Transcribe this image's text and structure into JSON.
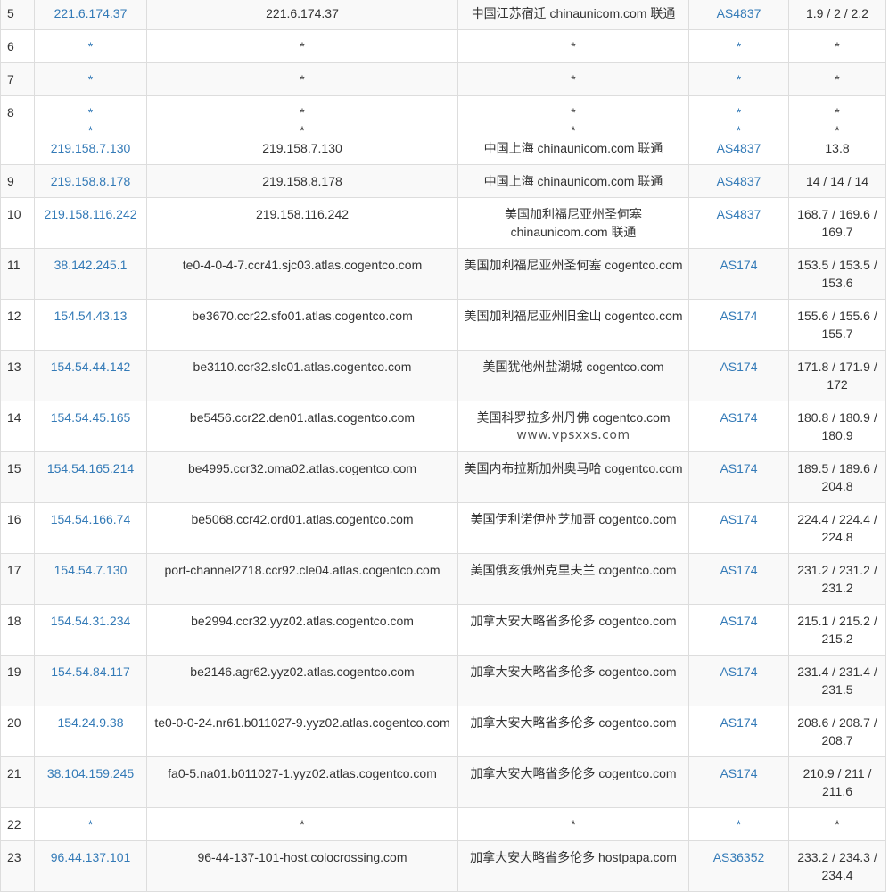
{
  "colors": {
    "link": "#337ab7",
    "text": "#333333",
    "stripe": "#f9f9f9",
    "border": "#dddddd"
  },
  "watermark": "www.vpsxxs.com",
  "rows": [
    {
      "hop": "5",
      "ip": "221.6.174.37",
      "host": "221.6.174.37",
      "loc": "中国江苏宿迁 chinaunicom.com 联通",
      "as": "AS4837",
      "time": "1.9 / 2 / 2.2"
    },
    {
      "hop": "6",
      "ip": "*",
      "host": "*",
      "loc": "*",
      "as": "*",
      "time": "*"
    },
    {
      "hop": "7",
      "ip": "*",
      "host": "*",
      "loc": "*",
      "as": "*",
      "time": "*"
    },
    {
      "hop": "8",
      "lines": [
        {
          "ip": "*",
          "host": "*",
          "loc": "*",
          "as": "*",
          "time": "*"
        },
        {
          "ip": "*",
          "host": "*",
          "loc": "*",
          "as": "*",
          "time": "*"
        },
        {
          "ip": "219.158.7.130",
          "host": "219.158.7.130",
          "loc": "中国上海 chinaunicom.com 联通",
          "as": "AS4837",
          "time": "13.8"
        }
      ]
    },
    {
      "hop": "9",
      "ip": "219.158.8.178",
      "host": "219.158.8.178",
      "loc": "中国上海 chinaunicom.com 联通",
      "as": "AS4837",
      "time": "14 / 14 / 14"
    },
    {
      "hop": "10",
      "ip": "219.158.116.242",
      "host": "219.158.116.242",
      "loc": "美国加利福尼亚州圣何塞 chinaunicom.com 联通",
      "as": "AS4837",
      "time": "168.7 / 169.6 / 169.7"
    },
    {
      "hop": "11",
      "ip": "38.142.245.1",
      "host": "te0-4-0-4-7.ccr41.sjc03.atlas.cogentco.com",
      "loc": "美国加利福尼亚州圣何塞 cogentco.com",
      "as": "AS174",
      "time": "153.5 / 153.5 / 153.6"
    },
    {
      "hop": "12",
      "ip": "154.54.43.13",
      "host": "be3670.ccr22.sfo01.atlas.cogentco.com",
      "loc": "美国加利福尼亚州旧金山 cogentco.com",
      "as": "AS174",
      "time": "155.6 / 155.6 / 155.7"
    },
    {
      "hop": "13",
      "ip": "154.54.44.142",
      "host": "be3110.ccr32.slc01.atlas.cogentco.com",
      "loc": "美国犹他州盐湖城 cogentco.com",
      "as": "AS174",
      "time": "171.8 / 171.9 / 172"
    },
    {
      "hop": "14",
      "ip": "154.54.45.165",
      "host": "be5456.ccr22.den01.atlas.cogentco.com",
      "loc": "美国科罗拉多州丹佛 cogentco.com",
      "as": "AS174",
      "time": "180.8 / 180.9 / 180.9",
      "watermark": true
    },
    {
      "hop": "15",
      "ip": "154.54.165.214",
      "host": "be4995.ccr32.oma02.atlas.cogentco.com",
      "loc": "美国内布拉斯加州奥马哈 cogentco.com",
      "as": "AS174",
      "time": "189.5 / 189.6 / 204.8"
    },
    {
      "hop": "16",
      "ip": "154.54.166.74",
      "host": "be5068.ccr42.ord01.atlas.cogentco.com",
      "loc": "美国伊利诺伊州芝加哥 cogentco.com",
      "as": "AS174",
      "time": "224.4 / 224.4 / 224.8"
    },
    {
      "hop": "17",
      "ip": "154.54.7.130",
      "host": "port-channel2718.ccr92.cle04.atlas.cogentco.com",
      "loc": "美国俄亥俄州克里夫兰 cogentco.com",
      "as": "AS174",
      "time": "231.2 / 231.2 / 231.2"
    },
    {
      "hop": "18",
      "ip": "154.54.31.234",
      "host": "be2994.ccr32.yyz02.atlas.cogentco.com",
      "loc": "加拿大安大略省多伦多 cogentco.com",
      "as": "AS174",
      "time": "215.1 / 215.2 / 215.2"
    },
    {
      "hop": "19",
      "ip": "154.54.84.117",
      "host": "be2146.agr62.yyz02.atlas.cogentco.com",
      "loc": "加拿大安大略省多伦多 cogentco.com",
      "as": "AS174",
      "time": "231.4 / 231.4 / 231.5"
    },
    {
      "hop": "20",
      "ip": "154.24.9.38",
      "host": "te0-0-0-24.nr61.b011027-9.yyz02.atlas.cogentco.com",
      "loc": "加拿大安大略省多伦多 cogentco.com",
      "as": "AS174",
      "time": "208.6 / 208.7 / 208.7"
    },
    {
      "hop": "21",
      "ip": "38.104.159.245",
      "host": "fa0-5.na01.b011027-1.yyz02.atlas.cogentco.com",
      "loc": "加拿大安大略省多伦多 cogentco.com",
      "as": "AS174",
      "time": "210.9 / 211 / 211.6"
    },
    {
      "hop": "22",
      "ip": "*",
      "host": "*",
      "loc": "*",
      "as": "*",
      "time": "*"
    },
    {
      "hop": "23",
      "ip": "96.44.137.101",
      "host": "96-44-137-101-host.colocrossing.com",
      "loc": "加拿大安大略省多伦多 hostpapa.com",
      "as": "AS36352",
      "time": "233.2 / 234.3 / 234.4"
    }
  ]
}
